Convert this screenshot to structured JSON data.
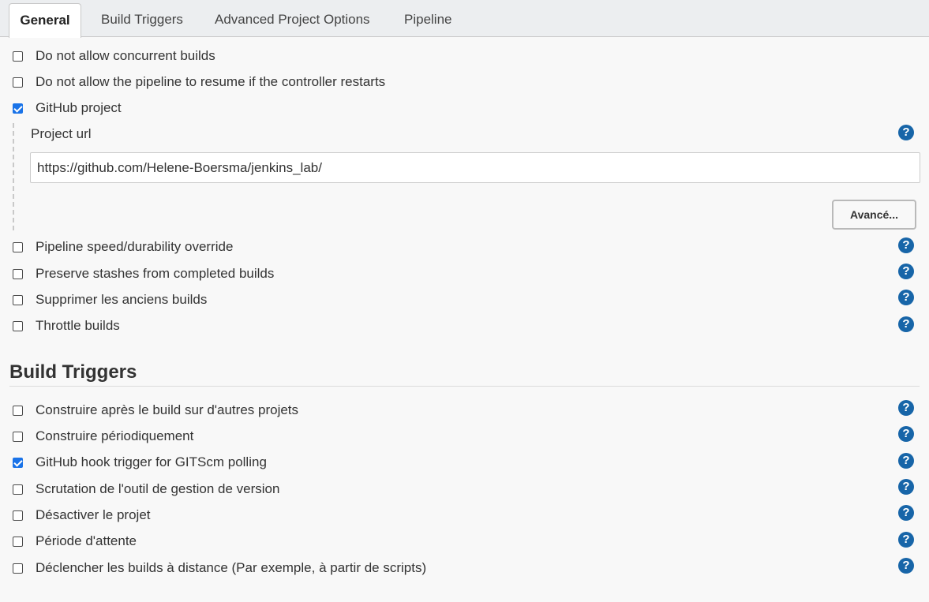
{
  "tabs": [
    {
      "label": "General",
      "active": true
    },
    {
      "label": "Build Triggers",
      "active": false
    },
    {
      "label": "Advanced Project Options",
      "active": false
    },
    {
      "label": "Pipeline",
      "active": false
    }
  ],
  "general": {
    "options": [
      {
        "label": "Do not allow concurrent builds",
        "checked": false
      },
      {
        "label": "Do not allow the pipeline to resume if the controller restarts",
        "checked": false
      },
      {
        "label": "GitHub project",
        "checked": true
      }
    ],
    "github_project": {
      "url_label": "Project url",
      "url_value": "https://github.com/Helene-Boersma/jenkins_lab/",
      "advanced_button": "Avancé..."
    },
    "more_options": [
      {
        "label": "Pipeline speed/durability override",
        "checked": false
      },
      {
        "label": "Preserve stashes from completed builds",
        "checked": false
      },
      {
        "label": "Supprimer les anciens builds",
        "checked": false
      },
      {
        "label": "Throttle builds",
        "checked": false
      }
    ]
  },
  "build_triggers": {
    "title": "Build Triggers",
    "options": [
      {
        "label": "Construire après le build sur d'autres projets",
        "checked": false
      },
      {
        "label": "Construire périodiquement",
        "checked": false
      },
      {
        "label": "GitHub hook trigger for GITScm polling",
        "checked": true
      },
      {
        "label": "Scrutation de l'outil de gestion de version",
        "checked": false
      },
      {
        "label": "Désactiver le projet",
        "checked": false
      },
      {
        "label": "Période d'attente",
        "checked": false
      },
      {
        "label": "Déclencher les builds à distance (Par exemple, à partir de scripts)",
        "checked": false
      }
    ]
  },
  "icons": {
    "help": "?"
  },
  "colors": {
    "checkbox_checked": "#1a73e8",
    "help_icon": "#1765a8",
    "tabbar_bg": "#eceef0",
    "page_bg": "#f8f8f8"
  }
}
